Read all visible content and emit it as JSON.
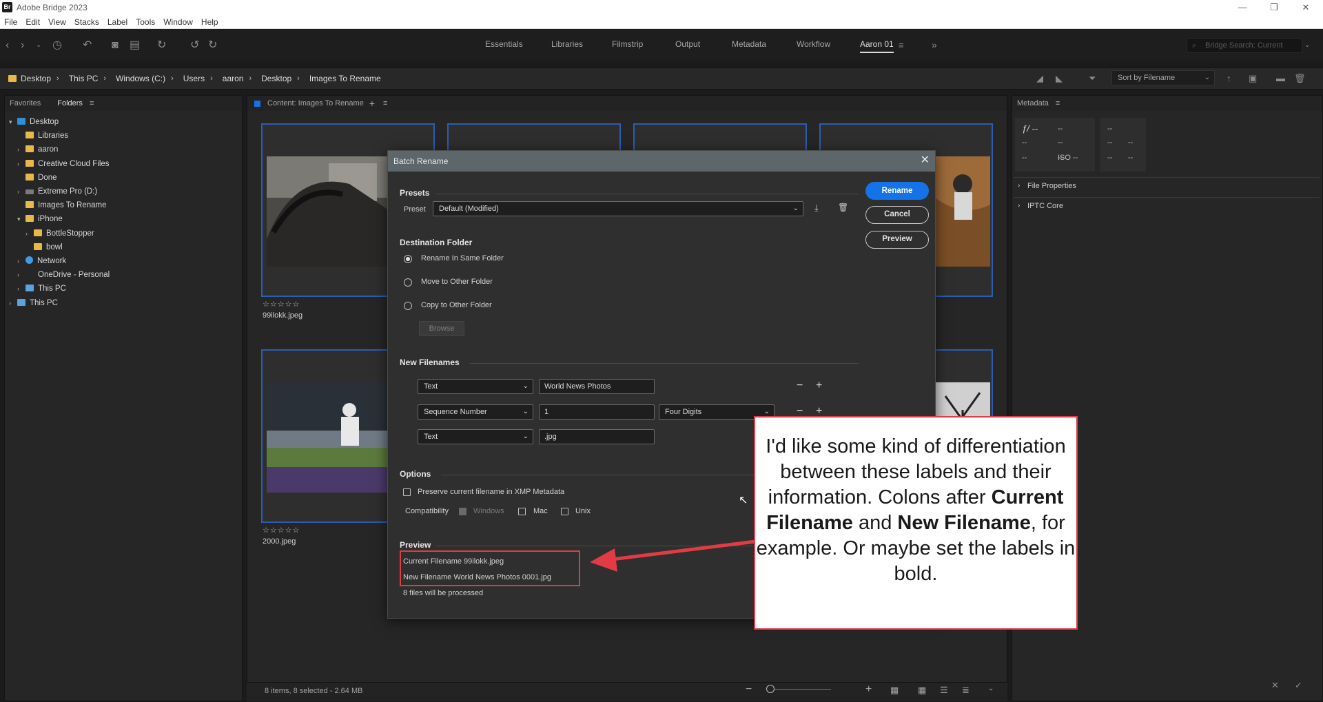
{
  "app": {
    "logo": "Br",
    "title": "Adobe Bridge 2023"
  },
  "window_controls": {
    "minimize": "—",
    "restore": "❐",
    "close": "✕"
  },
  "menu": [
    "File",
    "Edit",
    "View",
    "Stacks",
    "Label",
    "Tools",
    "Window",
    "Help"
  ],
  "workspaces": [
    "Essentials",
    "Libraries",
    "Filmstrip",
    "Output",
    "Metadata",
    "Workflow",
    "Aaron 01"
  ],
  "search": {
    "placeholder": "Bridge Search: Current"
  },
  "breadcrumb": [
    "Desktop",
    "This PC",
    "Windows (C:)",
    "Users",
    "aaron",
    "Desktop",
    "Images To Rename"
  ],
  "sort": {
    "label": "Sort by Filename"
  },
  "left_panel": {
    "tabs": [
      "Favorites",
      "Folders"
    ],
    "tree": [
      {
        "label": "Desktop",
        "depth": 0,
        "arrow": "open",
        "icon": "blue"
      },
      {
        "label": "Libraries",
        "depth": 1,
        "arrow": "",
        "icon": "folder"
      },
      {
        "label": "aaron",
        "depth": 1,
        "arrow": "closed",
        "icon": "folder"
      },
      {
        "label": "Creative Cloud Files",
        "depth": 1,
        "arrow": "closed",
        "icon": "folder"
      },
      {
        "label": "Done",
        "depth": 1,
        "arrow": "",
        "icon": "folder"
      },
      {
        "label": "Extreme Pro (D:)",
        "depth": 1,
        "arrow": "closed",
        "icon": "drive"
      },
      {
        "label": "Images To Rename",
        "depth": 1,
        "arrow": "",
        "icon": "folder"
      },
      {
        "label": "iPhone",
        "depth": 1,
        "arrow": "open",
        "icon": "folder"
      },
      {
        "label": "BottleStopper",
        "depth": 2,
        "arrow": "closed",
        "icon": "folder"
      },
      {
        "label": "bowl",
        "depth": 2,
        "arrow": "",
        "icon": "folder"
      },
      {
        "label": "Network",
        "depth": 1,
        "arrow": "closed",
        "icon": "net"
      },
      {
        "label": "OneDrive - Personal",
        "depth": 1,
        "arrow": "closed",
        "icon": "none"
      },
      {
        "label": "This PC",
        "depth": 1,
        "arrow": "closed",
        "icon": "pc"
      },
      {
        "label": "This PC",
        "depth": 0,
        "arrow": "closed",
        "icon": "pc"
      }
    ]
  },
  "content": {
    "header": "Content: Images To Rename",
    "captions": [
      "99ilokk.jpeg",
      "2000.jpeg"
    ],
    "stars": "☆☆☆☆☆"
  },
  "metadata_panel": {
    "header": "Metadata",
    "cells": [
      "ƒ/ --",
      "--",
      "--",
      "--",
      "--",
      "--",
      "--",
      "--",
      "--",
      "ISO --",
      "--",
      "--"
    ],
    "sections": [
      "File Properties",
      "IPTC Core"
    ]
  },
  "status": {
    "text": "8 items, 8 selected - 2.64 MB"
  },
  "dialog": {
    "title": "Batch Rename",
    "close": "✕",
    "presets_title": "Presets",
    "preset_label": "Preset",
    "preset_value": "Default (Modified)",
    "buttons": {
      "rename": "Rename",
      "cancel": "Cancel",
      "preview": "Preview"
    },
    "destination_title": "Destination Folder",
    "destination_options": [
      "Rename In Same Folder",
      "Move to Other Folder",
      "Copy to Other Folder"
    ],
    "browse": "Browse",
    "new_filenames_title": "New Filenames",
    "rows": [
      {
        "type": "Text",
        "value": "World News Photos",
        "extra": ""
      },
      {
        "type": "Sequence Number",
        "value": "1",
        "extra": "Four Digits"
      },
      {
        "type": "Text",
        "value": ".jpg",
        "extra": ""
      }
    ],
    "options_title": "Options",
    "preserve": "Preserve current filename in XMP Metadata",
    "compat_label": "Compatibility",
    "compat": [
      "Windows",
      "Mac",
      "Unix"
    ],
    "preview_title": "Preview",
    "current": "Current Filename 99ilokk.jpeg",
    "new": "New Filename World News Photos 0001.jpg",
    "count": "8 files will be processed"
  },
  "annotation": {
    "line1": "I'd like some kind of differentiation between these labels and their information. Colons after",
    "bold1": "Current Filename",
    "and": "and",
    "bold2": "New Filename",
    "line2": ", for example. Or maybe set the labels in bold."
  }
}
